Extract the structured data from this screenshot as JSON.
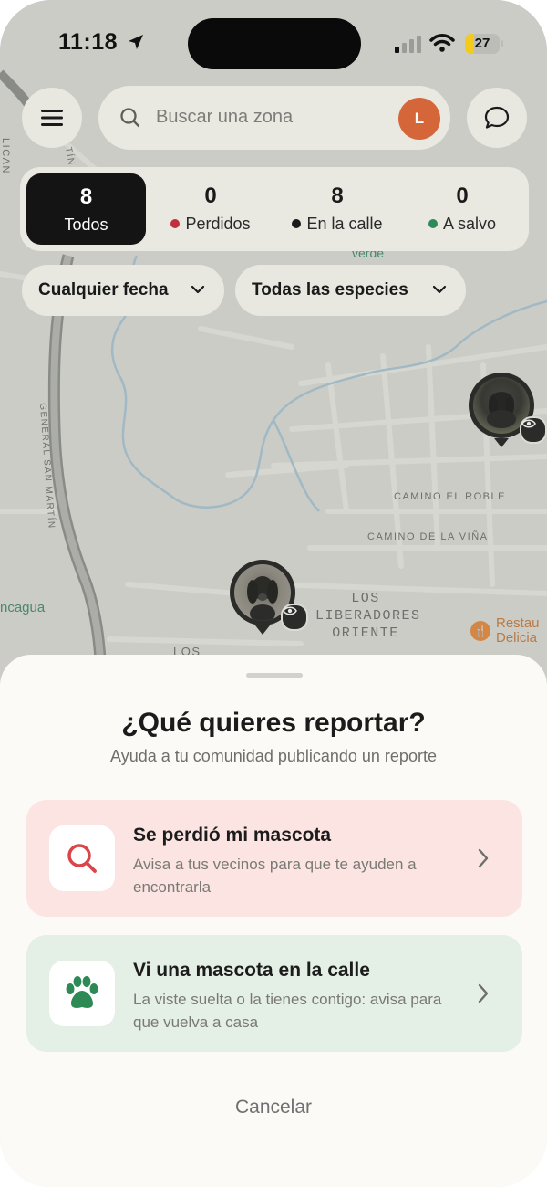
{
  "status_bar": {
    "time": "11:18",
    "battery": "27",
    "battery_level": 0.27
  },
  "header": {
    "search_placeholder": "Buscar una zona",
    "avatar_initial": "L"
  },
  "counters": [
    {
      "count": "8",
      "label": "Todos",
      "active": true,
      "dot_color": ""
    },
    {
      "count": "0",
      "label": "Perdidos",
      "active": false,
      "dot_color": "#c0303a"
    },
    {
      "count": "8",
      "label": "En la calle",
      "active": false,
      "dot_color": "#1a1a1a"
    },
    {
      "count": "0",
      "label": "A salvo",
      "active": false,
      "dot_color": "#2f8a5a"
    }
  ],
  "filters": {
    "date": "Cualquier fecha",
    "species": "Todas las especies"
  },
  "map_labels": {
    "camino_roble": "CAMINO EL ROBLE",
    "camino_vina": "CAMINO DE LA VIÑA",
    "liberadores_1": "LOS",
    "liberadores_2": "LIBERADORES",
    "liberadores_3": "ORIENTE",
    "general_san_martin": "GENERAL SAN MARTÍN",
    "aconcagua": "ncagua",
    "restaurant_1": "Restau",
    "restaurant_2": "Delicia",
    "los_bottom": "LOS",
    "verde": "verde",
    "lican": "LICAN",
    "tin": "TÍN"
  },
  "sheet": {
    "title": "¿Qué quieres reportar?",
    "subtitle": "Ayuda a tu comunidad publicando un reporte",
    "options": [
      {
        "title": "Se perdió mi mascota",
        "description": "Avisa a tus vecinos para que te ayuden a encontrarla",
        "icon": "search-icon",
        "bg": "#fbe4e2",
        "icon_color": "#d9454a"
      },
      {
        "title": "Vi una mascota en la calle",
        "description": "La viste suelta o la tienes contigo: avisa para que vuelva a casa",
        "icon": "paw-icon",
        "bg": "#e4efe6",
        "icon_color": "#2e8a55"
      }
    ],
    "cancel": "Cancelar"
  }
}
